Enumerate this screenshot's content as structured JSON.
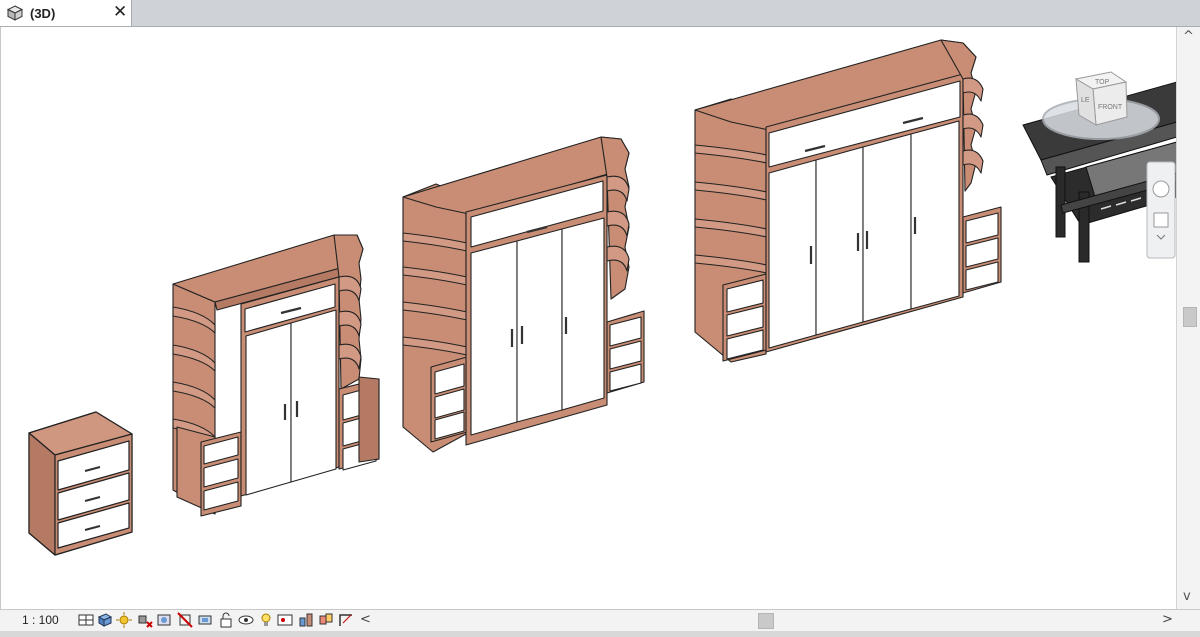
{
  "view_tab": {
    "label": "(3D)",
    "close_glyph": "✕",
    "icon": "3d-view-cube-icon"
  },
  "viewcube": {
    "top_label": "TOP",
    "front_label": "FRONT",
    "side_label": "LE"
  },
  "status": {
    "scale": "1 : 100"
  },
  "view_controls": [
    "detail-level-icon",
    "visual-style-icon",
    "sun-path-icon",
    "shadows-icon",
    "render-icon",
    "crop-view-icon",
    "show-crop-icon",
    "unlock-3d-view-icon",
    "temporary-hide-icon",
    "reveal-hidden-icon",
    "temp-view-properties-icon",
    "analytical-model-icon",
    "highlight-displacement-icon",
    "reveal-constraints-icon"
  ],
  "hscroll": {
    "left_glyph": "<",
    "right_glyph": ">"
  },
  "vscroll": {
    "up_glyph": "^",
    "down_glyph": "v"
  },
  "colors": {
    "wood": "#c88d74",
    "wood_dark": "#a9735c",
    "door": "#ffffff",
    "edge": "#222222",
    "tabbar": "#cfd3d8"
  }
}
